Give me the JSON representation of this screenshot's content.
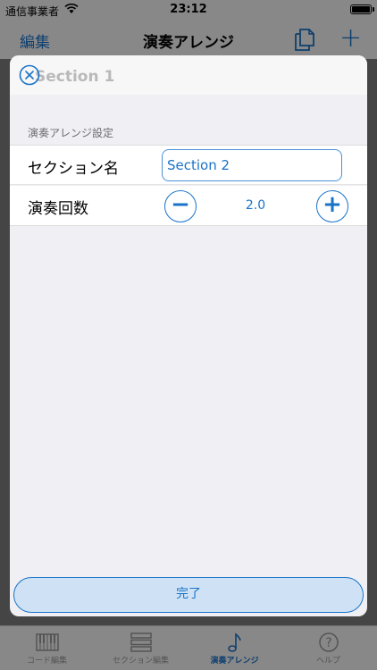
{
  "status_bar": {
    "carrier": "通信事業者",
    "time": "23:12"
  },
  "nav_bar": {
    "edit_label": "編集",
    "title": "演奏アレンジ",
    "add_label": "+"
  },
  "tab_bar": {
    "items": [
      {
        "label": "コード編集",
        "icon": "keyboard-icon",
        "active": false
      },
      {
        "label": "セクション編集",
        "icon": "list-icon",
        "active": false
      },
      {
        "label": "演奏アレンジ",
        "icon": "music-note-icon",
        "active": true
      },
      {
        "label": "ヘルプ",
        "icon": "help-icon",
        "active": false
      }
    ]
  },
  "sheet": {
    "background_item": "Section 1",
    "section_header": "演奏アレンジ設定",
    "section_name_label": "セクション名",
    "section_name_value": "Section 2",
    "play_count_label": "演奏回数",
    "play_count_value": "2.0",
    "minus_label": "−",
    "plus_label": "+",
    "done_label": "完了"
  },
  "colors": {
    "accent": "#1a73c8",
    "done_fill": "#cfe2f5",
    "sheet_bg": "#efeff4"
  }
}
